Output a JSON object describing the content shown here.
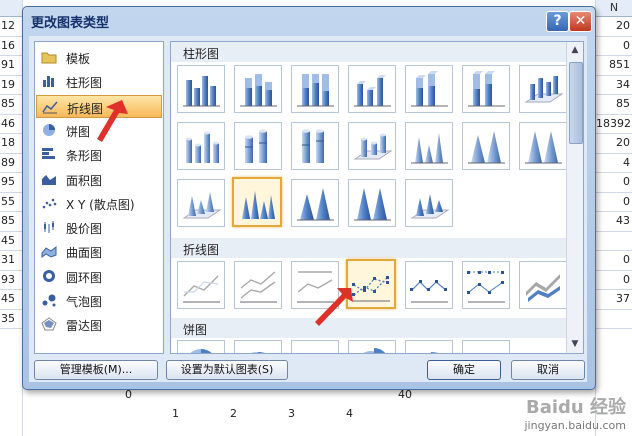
{
  "background": {
    "column_header": "N",
    "left_cells": [
      "12",
      "16",
      "91",
      "19",
      "85",
      "46",
      "18",
      "89",
      "95",
      "55",
      "85",
      "45",
      "31",
      "93",
      "45",
      "35"
    ],
    "right_cells": [
      "20",
      "0",
      "851",
      "34",
      "85",
      "18392",
      "20",
      "4",
      "0",
      "0",
      "43",
      "",
      "0",
      "0",
      "37",
      ""
    ],
    "axis_numbers": [
      "0",
      "1",
      "2",
      "3",
      "4",
      "40"
    ],
    "watermark_main": "Baidu 经验",
    "watermark_sub": "jingyan.baidu.com"
  },
  "dialog": {
    "title": "更改图表类型",
    "help_label": "?",
    "close_label": "✕",
    "categories": [
      {
        "label": "模板",
        "icon": "folder-icon"
      },
      {
        "label": "柱形图",
        "icon": "column-chart-icon"
      },
      {
        "label": "折线图",
        "icon": "line-chart-icon",
        "selected": true
      },
      {
        "label": "饼图",
        "icon": "pie-chart-icon"
      },
      {
        "label": "条形图",
        "icon": "bar-chart-icon"
      },
      {
        "label": "面积图",
        "icon": "area-chart-icon"
      },
      {
        "label": "X Y (散点图)",
        "icon": "scatter-chart-icon"
      },
      {
        "label": "股价图",
        "icon": "stock-chart-icon"
      },
      {
        "label": "曲面图",
        "icon": "surface-chart-icon"
      },
      {
        "label": "圆环图",
        "icon": "doughnut-chart-icon"
      },
      {
        "label": "气泡图",
        "icon": "bubble-chart-icon"
      },
      {
        "label": "雷达图",
        "icon": "radar-chart-icon"
      }
    ],
    "sections": {
      "column": "柱形图",
      "line": "折线图",
      "pie": "饼图"
    },
    "buttons": {
      "manage_templates": "管理模板(M)...",
      "set_default": "设置为默认图表(S)",
      "ok": "确定",
      "cancel": "取消"
    },
    "colors": {
      "selection_fill": "#f8b85a",
      "annotation_arrow": "#e0302a",
      "chart_blue": "#4f7fc5"
    }
  }
}
